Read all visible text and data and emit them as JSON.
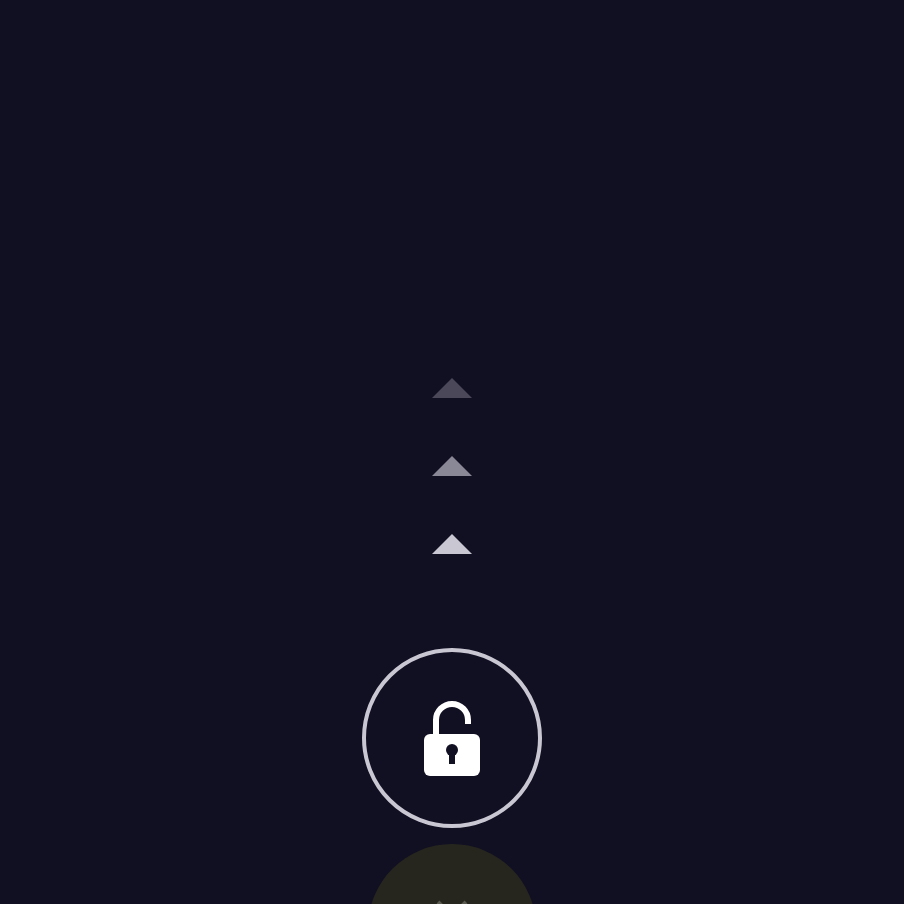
{
  "unlock_button": {
    "locked": false
  },
  "swipe_arrows": [
    {
      "color": "#4b4959"
    },
    {
      "color": "#8a8796"
    },
    {
      "color": "#c9c7d2"
    }
  ]
}
